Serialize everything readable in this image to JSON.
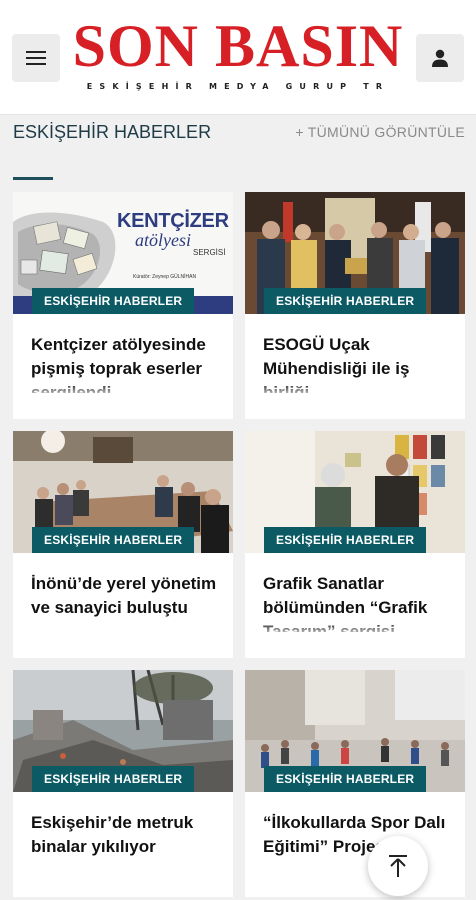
{
  "header": {
    "logo_title": "SON BASIN",
    "logo_subtitle": "ESKİŞEHİR MEDYA GURUP TR",
    "menu_icon": "hamburger-menu-icon",
    "user_icon": "user-icon",
    "brand_color": "#d71f26"
  },
  "section": {
    "title": "ESKİŞEHİR HABERLER",
    "view_all": "+ TÜMÜNÜ GÖRÜNTÜLE",
    "accent_color": "#0b5a64"
  },
  "cards": [
    {
      "category": "ESKİŞEHİR HABERLER",
      "title": "Kentçizer atölyesinde pişmiş toprak eserler sergilendi",
      "image_text": {
        "banner": "KENTÇİZER",
        "script": "atölyesi",
        "sub": "SERGİSİ",
        "small": "Küratör: Zeynep GÜLNİHAN"
      }
    },
    {
      "category": "ESKİŞEHİR HABERLER",
      "title": "ESOGÜ Uçak Mühendisliği ile iş birliği"
    },
    {
      "category": "ESKİŞEHİR HABERLER",
      "title": "İnönü’de yerel yönetim ve sanayici buluştu"
    },
    {
      "category": "ESKİŞEHİR HABERLER",
      "title": "Grafik Sanatlar bölümünden “Grafik Tasarım” sergisi"
    },
    {
      "category": "ESKİŞEHİR HABERLER",
      "title": "Eskişehir’de metruk binalar yıkılıyor"
    },
    {
      "category": "ESKİŞEHİR HABERLER",
      "title": "“İlkokullarda Spor Dalı Eğitimi” Projesi"
    }
  ],
  "scroll_top": {
    "icon": "arrow-up-to-top-icon"
  }
}
